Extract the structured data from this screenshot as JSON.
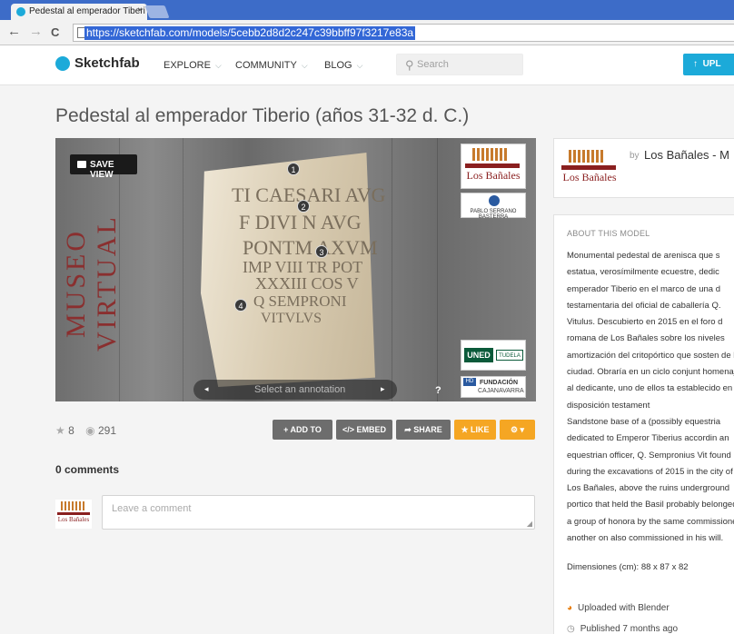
{
  "browser": {
    "tab_title": "Pedestal al emperador Tiberi",
    "tab_close": "×",
    "url": "https://sketchfab.com/models/5cebb2d8d2c247c39bbff97f3217e83a",
    "back": "←",
    "forward": "→",
    "reload": "C"
  },
  "header": {
    "logo": "Sketchfab",
    "nav": [
      "EXPLORE",
      "COMMUNITY",
      "BLOG"
    ],
    "nav_chevron": "⌵",
    "search_placeholder": "Search",
    "upload_label": "UPL",
    "upload_icon": "↑"
  },
  "model": {
    "title": "Pedestal al emperador Tiberio (años 31-32 d. C.)",
    "save_view": "SAVE VIEW",
    "museum_vertical": "MUSEO VIRTUAL",
    "inscription_lines": [
      "TI CAESARI AVG",
      "F DIVI N AVG",
      "PONTM AXVM",
      "IMP VIII TR POT",
      "XXXIII COS V",
      "Q SEMPRONI",
      "VITVLVS"
    ],
    "annotations": [
      "1",
      "2",
      "3",
      "4"
    ],
    "annotation_placeholder": "Select an annotation",
    "annotation_prev": "◂",
    "annotation_next": "▸",
    "help": "?",
    "logo_los_banales": "Los Bañales",
    "logo_museo_virtual": "MUSEO VIRTUAL",
    "logo_pablo_serrano": "PABLO SERRANO BASTERRA",
    "logo_uned": "UNED",
    "logo_tudela": "TUDELA",
    "logo_fundacion": "FUNDACIÓN",
    "logo_caja": "CAJANAVARRA",
    "logo_hd": "HD"
  },
  "stats": {
    "likes": "8",
    "views": "291",
    "star_icon": "★",
    "eye_icon": "◉"
  },
  "actions": {
    "add_to": "+ ADD TO",
    "embed": "</> EMBED",
    "share": "➦ SHARE",
    "like": "★ LIKE",
    "more": "⚙ ▾"
  },
  "comments": {
    "title": "0 comments",
    "placeholder": "Leave a comment"
  },
  "author": {
    "by": "by",
    "name": "Los Bañales - M"
  },
  "about": {
    "title": "ABOUT THIS MODEL",
    "description_es": "Monumental pedestal de arenisca que s estatua, verosímilmente ecuestre, dedic emperador Tiberio en el marco de una d testamentaria del oficial de caballería Q. Vitulus. Descubierto en 2015 en el foro d romana de Los Bañales sobre los niveles amortización del critopórtico que sosten de la ciudad. Obraría en un ciclo conjunt homenajes al dedicante, uno de ellos ta establecido en su disposición testament",
    "description_en": "Sandstone base of a (possibly equestria dedicated to Emperor Tiberius accordin an equestrian officer, Q. Sempronius Vit found during the excavations of 2015 in the city of Los Bañales, above the ruins underground portico that held the Basil probably belonged to a group of honora by the same commissioner, another on also commissioned in his will.",
    "dimensions": "Dimensiones (cm): 88 x 87 x 82",
    "uploaded": "Uploaded with Blender",
    "published": "Published 7 months ago"
  },
  "colors": {
    "accent": "#1caad9",
    "like": "#f5a623",
    "button_grey": "#6d6d6d",
    "brand_red": "#8a1f1f"
  }
}
